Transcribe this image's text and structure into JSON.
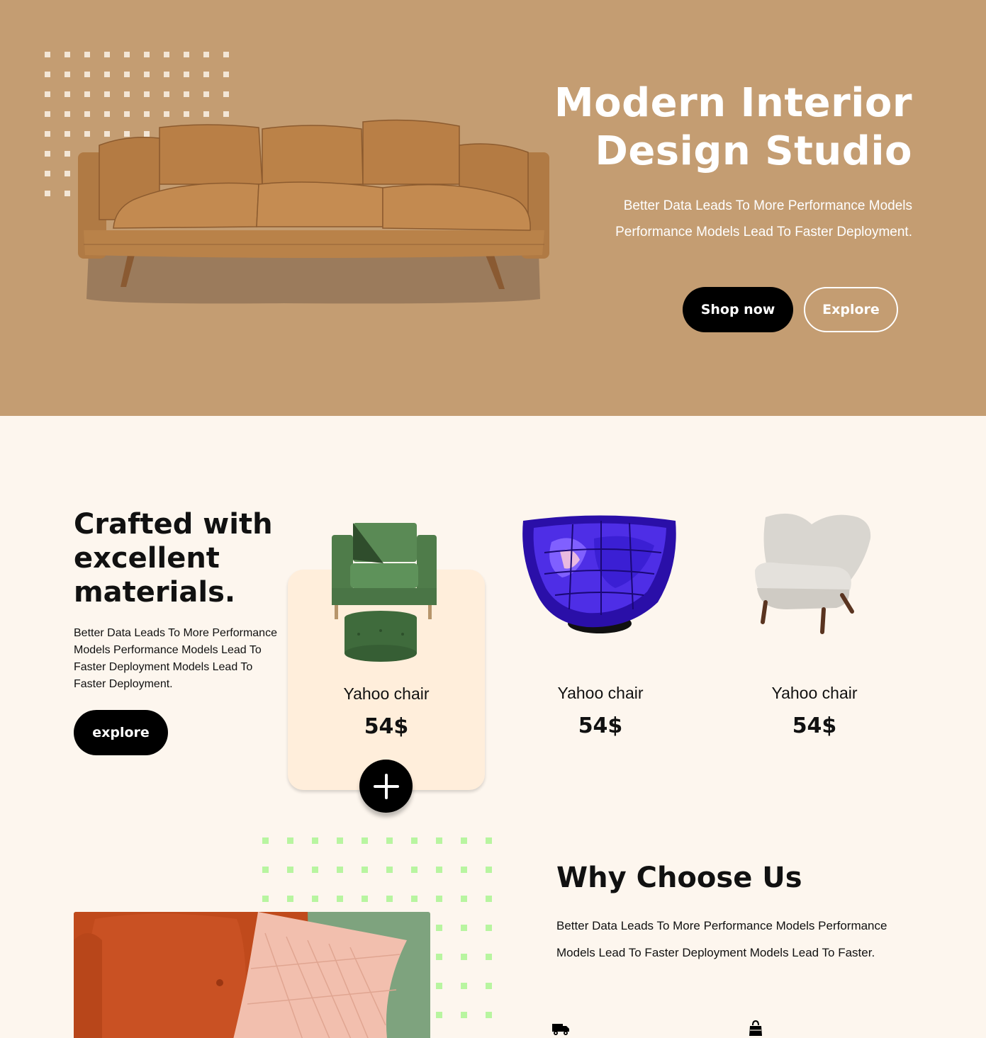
{
  "hero": {
    "title_line1": "Modern Interior",
    "title_line2": "Design Studio",
    "description": "Better Data Leads To More Performance Models Performance Models Lead To Faster Deployment.",
    "shop_label": "Shop now",
    "explore_label": "Explore",
    "background_color": "#c49d72"
  },
  "crafted": {
    "title": "Crafted with excellent materials.",
    "description": "Better Data Leads To More Performance Models Performance Models Lead To Faster Deployment Models Lead To Faster Deployment.",
    "explore_label": "explore"
  },
  "products": [
    {
      "name": "Yahoo chair",
      "price": "54$",
      "image": "green-armchair-with-ottoman",
      "highlighted": true
    },
    {
      "name": "Yahoo chair",
      "price": "54$",
      "image": "purple-bubble-chair",
      "highlighted": false
    },
    {
      "name": "Yahoo chair",
      "price": "54$",
      "image": "white-boucle-armchair",
      "highlighted": false
    }
  ],
  "why": {
    "title": "Why Choose Us",
    "description": "Better Data Leads To More Performance Models Performance Models Lead To Faster Deployment Models Lead To Faster.",
    "features": [
      {
        "icon": "truck-icon"
      },
      {
        "icon": "shopping-bag-icon"
      }
    ]
  },
  "colors": {
    "page_bg": "#fdf6ee",
    "card_bg": "#ffeedb",
    "accent_dots": "#b8f5a0",
    "button": "#000000"
  }
}
